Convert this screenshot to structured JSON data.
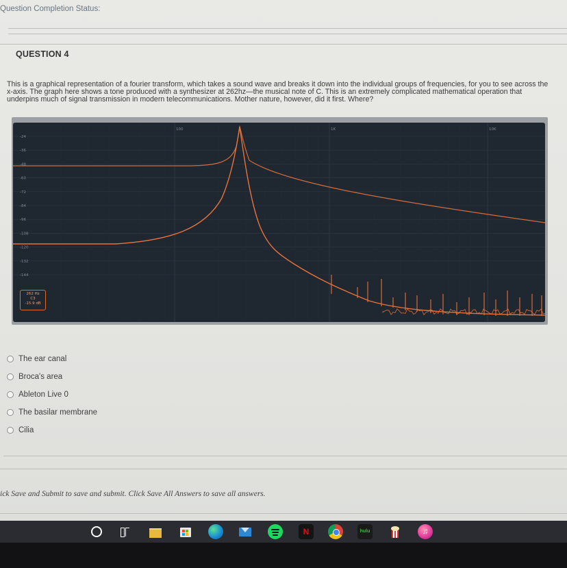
{
  "header": {
    "completion_status": "Question Completion Status:"
  },
  "question": {
    "title": "QUESTION 4",
    "text": "This is a graphical representation of a fourier transform, which takes a sound wave and breaks it down into the individual groups of frequencies, for you to see across the x-axis. The graph here shows a tone produced with a synthesizer at 262hz—the musical note of C. This is an extremely complicated mathematical operation that underpins much of signal transmission in modern telecommunications. Mother nature, however, did it first. Where?"
  },
  "chart_data": {
    "type": "line",
    "title": "",
    "y_ticks": [
      "-24",
      "-36",
      "-48",
      "-60",
      "-72",
      "-84",
      "-96",
      "-108",
      "-120",
      "-132",
      "-144"
    ],
    "x_ticks": [
      "100",
      "1K",
      "10K"
    ],
    "peak_readout": [
      "262 Hz",
      "C3",
      "-15.9 dB"
    ],
    "peak_frequency_hz": 262,
    "colors": {
      "background": "#1f2731",
      "line": "#e8733a",
      "grid": "#2f3944"
    }
  },
  "answers": [
    {
      "label": "The ear canal"
    },
    {
      "label": "Broca's area"
    },
    {
      "label": "Ableton Live 0"
    },
    {
      "label": "The basilar membrane"
    },
    {
      "label": "Cilia"
    }
  ],
  "footer": {
    "note": "ick Save and Submit to save and submit. Click Save All Answers to save all answers."
  },
  "taskbar": {
    "icons": [
      "cortana-circle-icon",
      "task-view-icon",
      "file-explorer-icon",
      "store-icon",
      "edge-icon",
      "mail-icon",
      "spotify-icon",
      "netflix-icon",
      "chrome-icon",
      "hulu-icon",
      "popcorn-icon",
      "itunes-icon"
    ],
    "netflix_label": "N",
    "hulu_label": "hulu"
  }
}
